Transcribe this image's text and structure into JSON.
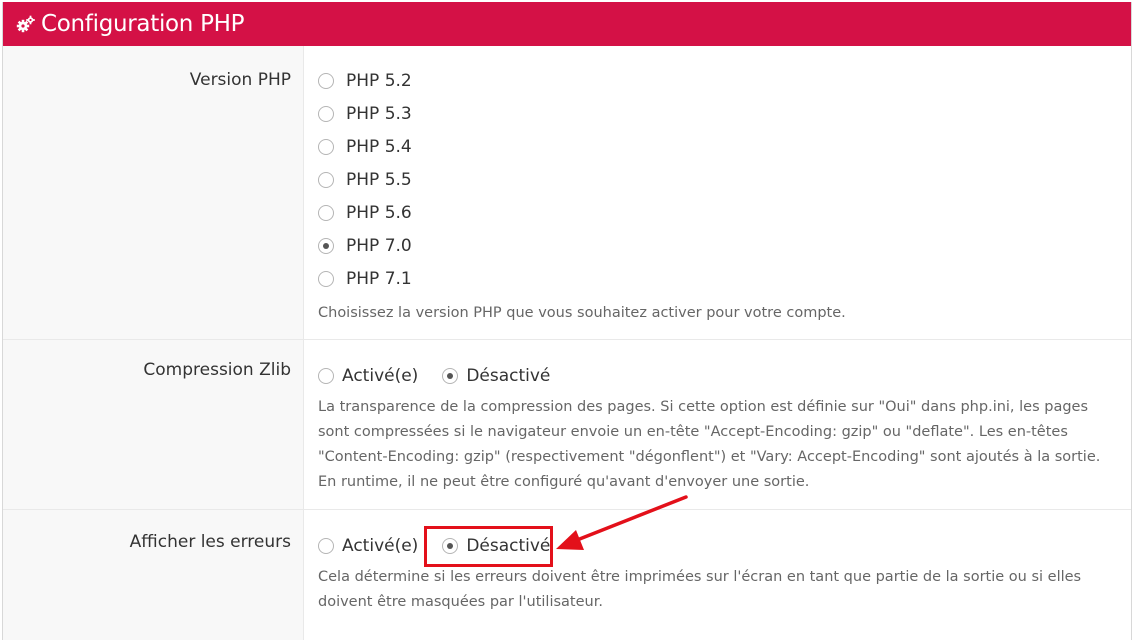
{
  "panel": {
    "title": "Configuration PHP",
    "header_icon": "gears-icon",
    "header_color": "#d41146"
  },
  "php_version": {
    "label": "Version PHP",
    "options": [
      "PHP 5.2",
      "PHP 5.3",
      "PHP 5.4",
      "PHP 5.5",
      "PHP 5.6",
      "PHP 7.0",
      "PHP 7.1"
    ],
    "selected": "PHP 7.0",
    "help": "Choisissez la version PHP que vous souhaitez activer pour votre compte."
  },
  "zlib": {
    "label": "Compression Zlib",
    "options": [
      "Activé(e)",
      "Désactivé"
    ],
    "selected": "Désactivé",
    "help": "La transparence de la compression des pages. Si cette option est définie sur \"Oui\" dans php.ini, les pages sont compressées si le navigateur envoie un en-tête \"Accept-Encoding: gzip\" ou \"deflate\". Les en-têtes \"Content-Encoding: gzip\" (respectivement \"dégonflent\") et \"Vary: Accept-Encoding\" sont ajoutés à la sortie. En runtime, il ne peut être configuré qu'avant d'envoyer une sortie."
  },
  "display_errors": {
    "label": "Afficher les erreurs",
    "options": [
      "Activé(e)",
      "Désactivé"
    ],
    "selected": "Désactivé",
    "help": "Cela détermine si les erreurs doivent être imprimées sur l'écran en tant que partie de la sortie ou si elles doivent être masquées par l'utilisateur."
  },
  "annotation": {
    "color": "#e3101a"
  }
}
